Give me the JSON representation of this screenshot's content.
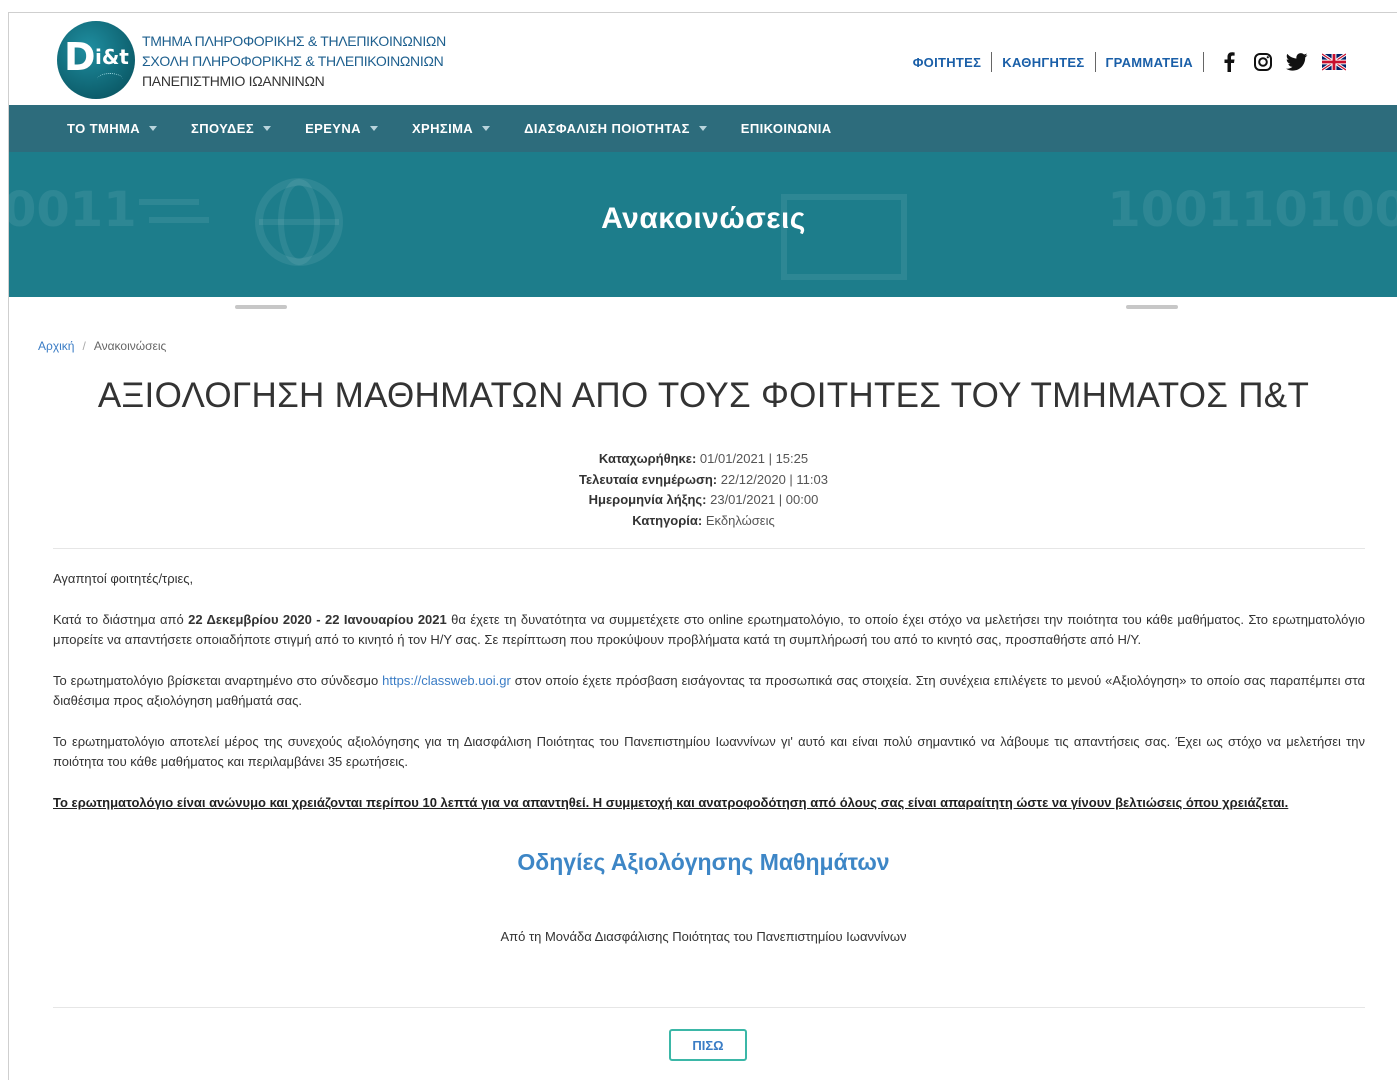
{
  "header": {
    "logo_d": "D",
    "logo_it": "i&t",
    "line1": "ΤΜΗΜΑ ΠΛΗΡΟΦΟΡΙΚΗΣ & ΤΗΛΕΠΙΚΟΙΝΩΝΙΩΝ",
    "line2": "ΣΧΟΛΗ ΠΛΗΡΟΦΟΡΙΚΗΣ & ΤΗΛΕΠΙΚΟΙΝΩΝΙΩΝ",
    "line3": "ΠΑΝΕΠΙΣΤΗΜΙΟ ΙΩΑΝΝΙΝΩΝ",
    "links": [
      "ΦΟΙΤΗΤΕΣ",
      "ΚΑΘΗΓΗΤΕΣ",
      "ΓΡΑΜΜΑΤΕΙΑ"
    ],
    "social_icons": [
      "facebook-icon",
      "instagram-icon",
      "twitter-icon",
      "uk-flag-icon"
    ]
  },
  "nav": {
    "items": [
      "ΤΟ ΤΜΗΜΑ",
      "ΣΠΟΥΔΕΣ",
      "ΕΡΕΥΝΑ",
      "ΧΡΗΣΙΜΑ",
      "ΔΙΑΣΦΑΛΙΣΗ ΠΟΙΟΤΗΤΑΣ",
      "ΕΠΙΚΟΙΝΩΝΙΑ"
    ]
  },
  "banner": {
    "title": "Ανακοινώσεις",
    "deco_left": "0011",
    "deco_right": "100110100"
  },
  "breadcrumb": {
    "home": "Αρχική",
    "separator": "/",
    "current": "Ανακοινώσεις"
  },
  "article": {
    "title": "ΑΞΙΟΛΟΓΗΣΗ ΜΑΘΗΜΑΤΩΝ ΑΠΟ ΤΟΥΣ ΦΟΙΤΗΤΕΣ ΤΟΥ ΤΜΗΜΑΤΟΣ Π&Τ",
    "meta": {
      "posted_label": "Καταχωρήθηκε:",
      "posted_value": " 01/01/2021 | 15:25",
      "updated_label": "Τελευταία ενημέρωση:",
      "updated_value": " 22/12/2020 | 11:03",
      "expires_label": "Ημερομηνία λήξης:",
      "expires_value": " 23/01/2021 | 00:00",
      "category_label": "Κατηγορία:",
      "category_value": " Εκδηλώσεις"
    },
    "greeting": "Αγαπητοί φοιτητές/τριες,",
    "p1_a": "Κατά το διάστημα από ",
    "p1_bold": "22 Δεκεμβρίου 2020 - 22 Ιανουαρίου 2021",
    "p1_b": " θα έχετε τη δυνατότητα να συμμετέχετε στο online ερωτηματολόγιο, το οποίο έχει στόχο να μελετήσει την ποιότητα του κάθε μαθήματος. Στο ερωτηματολόγιο μπορείτε να απαντήσετε οποιαδήποτε στιγμή από το κινητό ή τον Η/Υ σας. Σε περίπτωση που προκύψουν προβλήματα κατά τη συμπλήρωσή του από το κινητό σας,   προσπαθήστε από Η/Υ.",
    "p2_a": "Το ερωτηματολόγιο βρίσκεται αναρτημένο στο σύνδεσμο ",
    "p2_link": "https://classweb.uoi.gr",
    "p2_b": " στον οποίο έχετε πρόσβαση εισάγοντας τα προσωπικά σας στοιχεία. Στη συνέχεια επιλέγετε το μενού «Αξιολόγηση» το οποίο σας  παραπέμπει στα διαθέσιμα προς αξιολόγηση μαθήματά σας.",
    "p3": "Το ερωτηματολόγιο αποτελεί μέρος της συνεχούς αξιολόγησης για τη Διασφάλιση Ποιότητας του Πανεπιστημίου Ιωαννίνων γι' αυτό και είναι πολύ σημαντικό να λάβουμε τις απαντήσεις σας. Έχει ως στόχο να μελετήσει την ποιότητα του κάθε μαθήματος και περιλαμβάνει 35 ερωτήσεις.",
    "p4": "Το ερωτηματολόγιο είναι ανώνυμο και χρειάζονται περίπου 10 λεπτά για να απαντηθεί. Η συμμετοχή και ανατροφοδότηση από όλους σας είναι απαραίτητη ώστε να γίνουν βελτιώσεις όπου χρειάζεται.",
    "guide_link": "Οδηγίες Αξιολόγησης Μαθημάτων",
    "signature": "Από τη Μονάδα Διασφάλισης Ποιότητας του Πανεπιστημίου Ιωαννίνων",
    "back_button": "ΠΙΣΩ"
  },
  "colors": {
    "nav_bg": "#2d6c7c",
    "banner_bg": "#1d7d8b",
    "link": "#3a7cc5",
    "button_border": "#3bb7a7"
  }
}
